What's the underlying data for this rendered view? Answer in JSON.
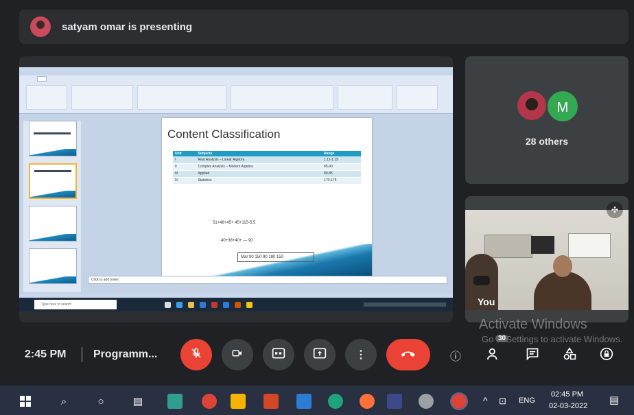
{
  "presenting": {
    "text": "satyam omar is presenting"
  },
  "shared_slide": {
    "title": "Content Classification",
    "table_headers": [
      "Unit",
      "Subjects",
      "Range"
    ],
    "table_rows": [
      [
        "I",
        "Real Analysis – Linear Algebra",
        "1.11-1.19"
      ],
      [
        "II",
        "Complex Analysis – Modern Algebra",
        "85-90"
      ],
      [
        "III",
        "Applied",
        "80-85"
      ],
      [
        "IV",
        "Statistics",
        "170-175"
      ]
    ],
    "eq1": "51+48+45+ 45+115-5.5",
    "eq2": "40+38+40+ — 90",
    "eq_box": "Mar  90  150  90  180  150",
    "notes": "Click to add notes",
    "search_placeholder": "Type here to search"
  },
  "participants": {
    "others_label": "28 others",
    "avatar_letter": "M"
  },
  "self_view": {
    "label": "You"
  },
  "watermark": {
    "title": "Activate Windows",
    "subtitle": "Go to Settings to activate Windows."
  },
  "meeting_bar": {
    "time": "2:45 PM",
    "separator": "|",
    "meeting_name": "Programm...",
    "raise_count": "30"
  },
  "taskbar": {
    "lang": "ENG",
    "time": "02:45 PM",
    "date": "02-03-2022"
  },
  "colors": {
    "end_call": "#ea4335",
    "mic_off": "#ea4335",
    "avatar_m": "#34a853",
    "background": "#202124"
  }
}
